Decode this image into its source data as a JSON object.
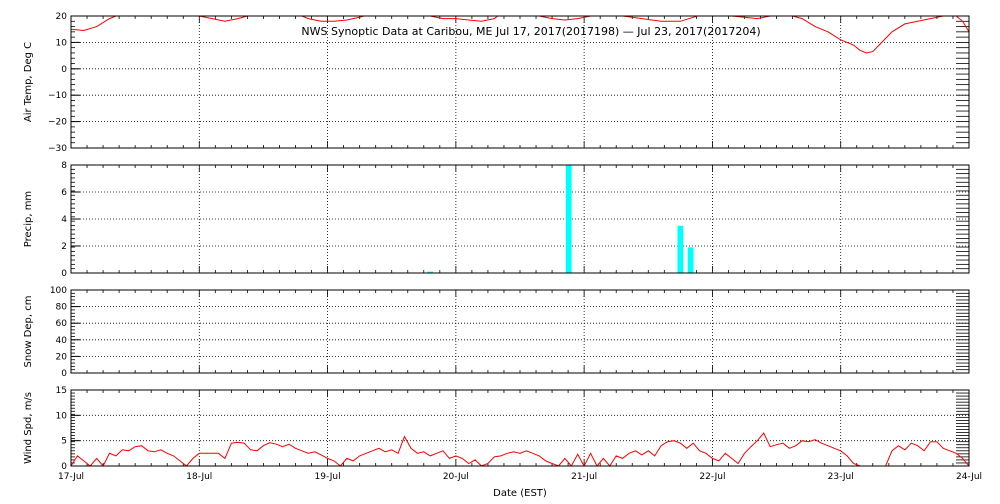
{
  "title": "NWS Synoptic Data at Caribou, ME   Jul 17, 2017(2017198) — Jul 23, 2017(2017204)",
  "xlabel": "Date (EST)",
  "x_ticks": [
    "17-Jul",
    "18-Jul",
    "19-Jul",
    "20-Jul",
    "21-Jul",
    "22-Jul",
    "23-Jul",
    "24-Jul"
  ],
  "colors": {
    "temperature": "#ff0000",
    "precip": "#00ffff",
    "wind": "#ff0000",
    "axis": "#000000"
  },
  "chart_data": [
    {
      "type": "line",
      "name": "air-temp",
      "ylabel": "Air Temp, Deg C",
      "ylim": [
        -30,
        20
      ],
      "yticks": [
        "20",
        "10",
        "0",
        "−10",
        "−20",
        "−30"
      ],
      "ytick_values": [
        20,
        10,
        0,
        -10,
        -20,
        -30
      ],
      "x_units": "days since 17-Jul 00:00 EST",
      "grid": true,
      "points": [
        [
          0.0,
          15
        ],
        [
          0.1,
          14.5
        ],
        [
          0.2,
          16
        ],
        [
          0.3,
          19
        ],
        [
          0.4,
          21
        ],
        [
          0.7,
          23
        ],
        [
          0.95,
          21
        ],
        [
          1.0,
          20
        ],
        [
          1.1,
          19
        ],
        [
          1.2,
          18
        ],
        [
          1.3,
          19
        ],
        [
          1.45,
          21
        ],
        [
          1.6,
          22
        ],
        [
          1.75,
          21
        ],
        [
          1.85,
          19
        ],
        [
          1.95,
          18
        ],
        [
          2.05,
          18
        ],
        [
          2.15,
          18.5
        ],
        [
          2.25,
          19.5
        ],
        [
          2.35,
          21
        ],
        [
          2.5,
          22
        ],
        [
          2.7,
          21
        ],
        [
          2.8,
          20
        ],
        [
          2.9,
          19
        ],
        [
          3.0,
          19
        ],
        [
          3.1,
          18.5
        ],
        [
          3.2,
          18
        ],
        [
          3.3,
          19
        ],
        [
          3.35,
          21
        ],
        [
          3.45,
          22
        ],
        [
          3.55,
          21
        ],
        [
          3.65,
          20
        ],
        [
          3.75,
          19
        ],
        [
          3.85,
          18.5
        ],
        [
          3.95,
          19
        ],
        [
          4.05,
          20
        ],
        [
          4.15,
          21
        ],
        [
          4.3,
          20
        ],
        [
          4.45,
          19
        ],
        [
          4.6,
          18
        ],
        [
          4.75,
          18
        ],
        [
          4.85,
          19.5
        ],
        [
          4.95,
          21
        ],
        [
          5.05,
          21
        ],
        [
          5.15,
          20
        ],
        [
          5.25,
          19.5
        ],
        [
          5.35,
          19
        ],
        [
          5.45,
          20
        ],
        [
          5.55,
          21
        ],
        [
          5.7,
          19
        ],
        [
          5.8,
          16
        ],
        [
          5.9,
          14
        ],
        [
          6.0,
          11
        ],
        [
          6.1,
          9
        ],
        [
          6.15,
          7
        ],
        [
          6.2,
          6
        ],
        [
          6.25,
          6.5
        ],
        [
          6.3,
          9
        ],
        [
          6.4,
          14
        ],
        [
          6.5,
          17
        ],
        [
          6.6,
          18
        ],
        [
          6.7,
          19
        ],
        [
          6.8,
          20
        ],
        [
          6.9,
          20
        ],
        [
          6.95,
          18
        ],
        [
          7.0,
          14
        ],
        [
          7.05,
          12
        ],
        [
          7.1,
          11
        ]
      ]
    },
    {
      "type": "bar",
      "name": "precip",
      "ylabel": "Precip, mm",
      "ylim": [
        0,
        8
      ],
      "yticks": [
        "8",
        "6",
        "4",
        "2",
        "0"
      ],
      "ytick_values": [
        8,
        6,
        4,
        2,
        0
      ],
      "bar_width_days": 0.045,
      "grid": true,
      "bars": [
        {
          "x": 2.8,
          "value": 0.1
        },
        {
          "x": 3.88,
          "value": 10.0
        },
        {
          "x": 4.75,
          "value": 3.5
        },
        {
          "x": 4.83,
          "value": 1.9
        }
      ]
    },
    {
      "type": "line",
      "name": "snow-depth",
      "ylabel": "Snow Dep, cm",
      "ylim": [
        0,
        100
      ],
      "yticks": [
        "100",
        "80",
        "60",
        "40",
        "20",
        "0"
      ],
      "ytick_values": [
        100,
        80,
        60,
        40,
        20,
        0
      ],
      "grid": true,
      "points": []
    },
    {
      "type": "line",
      "name": "wind-speed",
      "ylabel": "Wind Spd, m/s",
      "ylim": [
        0,
        15
      ],
      "yticks": [
        "15",
        "10",
        "5",
        "0"
      ],
      "ytick_values": [
        15,
        10,
        5,
        0
      ],
      "grid": true,
      "points": [
        [
          0.0,
          0
        ],
        [
          0.05,
          2.0
        ],
        [
          0.1,
          1.0
        ],
        [
          0.15,
          0
        ],
        [
          0.2,
          1.5
        ],
        [
          0.25,
          0
        ],
        [
          0.3,
          2.5
        ],
        [
          0.35,
          2.0
        ],
        [
          0.4,
          3.2
        ],
        [
          0.45,
          3.0
        ],
        [
          0.5,
          3.8
        ],
        [
          0.55,
          4.0
        ],
        [
          0.6,
          3.0
        ],
        [
          0.65,
          2.8
        ],
        [
          0.7,
          3.2
        ],
        [
          0.75,
          2.5
        ],
        [
          0.8,
          2.0
        ],
        [
          0.85,
          1.0
        ],
        [
          0.9,
          0
        ],
        [
          0.95,
          1.5
        ],
        [
          1.0,
          2.5
        ],
        [
          1.05,
          2.5
        ],
        [
          1.1,
          2.5
        ],
        [
          1.15,
          2.5
        ],
        [
          1.2,
          1.5
        ],
        [
          1.25,
          4.5
        ],
        [
          1.3,
          4.7
        ],
        [
          1.35,
          4.5
        ],
        [
          1.4,
          3.2
        ],
        [
          1.45,
          3.0
        ],
        [
          1.5,
          4.0
        ],
        [
          1.55,
          4.6
        ],
        [
          1.6,
          4.3
        ],
        [
          1.65,
          3.8
        ],
        [
          1.7,
          4.3
        ],
        [
          1.75,
          3.5
        ],
        [
          1.8,
          3.0
        ],
        [
          1.85,
          2.5
        ],
        [
          1.9,
          2.8
        ],
        [
          1.95,
          2.2
        ],
        [
          2.0,
          1.5
        ],
        [
          2.05,
          1.0
        ],
        [
          2.1,
          0
        ],
        [
          2.15,
          1.5
        ],
        [
          2.2,
          1.0
        ],
        [
          2.25,
          2.0
        ],
        [
          2.3,
          2.5
        ],
        [
          2.35,
          3.0
        ],
        [
          2.4,
          3.5
        ],
        [
          2.45,
          2.8
        ],
        [
          2.5,
          3.2
        ],
        [
          2.55,
          2.5
        ],
        [
          2.6,
          5.8
        ],
        [
          2.65,
          3.5
        ],
        [
          2.7,
          2.5
        ],
        [
          2.75,
          2.8
        ],
        [
          2.8,
          2.0
        ],
        [
          2.85,
          2.5
        ],
        [
          2.9,
          3.0
        ],
        [
          2.95,
          1.5
        ],
        [
          3.0,
          2.0
        ],
        [
          3.05,
          1.5
        ],
        [
          3.1,
          0.5
        ],
        [
          3.15,
          1.2
        ],
        [
          3.2,
          0
        ],
        [
          3.25,
          0.5
        ],
        [
          3.3,
          1.8
        ],
        [
          3.35,
          2.0
        ],
        [
          3.4,
          2.5
        ],
        [
          3.45,
          2.8
        ],
        [
          3.5,
          2.5
        ],
        [
          3.55,
          3.0
        ],
        [
          3.6,
          2.5
        ],
        [
          3.65,
          2.0
        ],
        [
          3.7,
          1.0
        ],
        [
          3.75,
          0.5
        ],
        [
          3.8,
          0
        ],
        [
          3.85,
          1.5
        ],
        [
          3.9,
          0
        ],
        [
          3.95,
          2.3
        ],
        [
          4.0,
          0
        ],
        [
          4.05,
          2.5
        ],
        [
          4.1,
          0
        ],
        [
          4.15,
          1.5
        ],
        [
          4.2,
          0
        ],
        [
          4.25,
          2.0
        ],
        [
          4.3,
          1.5
        ],
        [
          4.35,
          2.5
        ],
        [
          4.4,
          3.0
        ],
        [
          4.45,
          2.2
        ],
        [
          4.5,
          3.0
        ],
        [
          4.55,
          2.0
        ],
        [
          4.6,
          4.0
        ],
        [
          4.65,
          4.8
        ],
        [
          4.7,
          5.0
        ],
        [
          4.75,
          4.5
        ],
        [
          4.8,
          3.5
        ],
        [
          4.85,
          4.5
        ],
        [
          4.9,
          3.0
        ],
        [
          4.95,
          2.5
        ],
        [
          5.0,
          1.5
        ],
        [
          5.05,
          1.0
        ],
        [
          5.1,
          2.5
        ],
        [
          5.15,
          1.5
        ],
        [
          5.2,
          0.5
        ],
        [
          5.25,
          2.5
        ],
        [
          5.3,
          3.8
        ],
        [
          5.35,
          5.0
        ],
        [
          5.4,
          6.5
        ],
        [
          5.45,
          3.8
        ],
        [
          5.5,
          4.2
        ],
        [
          5.55,
          4.5
        ],
        [
          5.6,
          3.5
        ],
        [
          5.65,
          4.0
        ],
        [
          5.7,
          5.0
        ],
        [
          5.75,
          4.8
        ],
        [
          5.8,
          5.2
        ],
        [
          5.85,
          4.5
        ],
        [
          5.9,
          4.0
        ],
        [
          5.95,
          3.5
        ],
        [
          6.0,
          3.0
        ],
        [
          6.05,
          2.0
        ],
        [
          6.1,
          0.5
        ],
        [
          6.15,
          0
        ],
        [
          6.2,
          0
        ],
        [
          6.25,
          0
        ],
        [
          6.3,
          0
        ],
        [
          6.35,
          0
        ],
        [
          6.4,
          3.0
        ],
        [
          6.45,
          4.0
        ],
        [
          6.5,
          3.2
        ],
        [
          6.55,
          4.5
        ],
        [
          6.6,
          4.0
        ],
        [
          6.65,
          3.0
        ],
        [
          6.7,
          4.8
        ],
        [
          6.75,
          4.8
        ],
        [
          6.8,
          3.5
        ],
        [
          6.85,
          3.0
        ],
        [
          6.9,
          2.5
        ],
        [
          6.95,
          1.5
        ],
        [
          7.0,
          0
        ],
        [
          7.05,
          1.5
        ],
        [
          7.1,
          2.5
        ]
      ]
    }
  ]
}
